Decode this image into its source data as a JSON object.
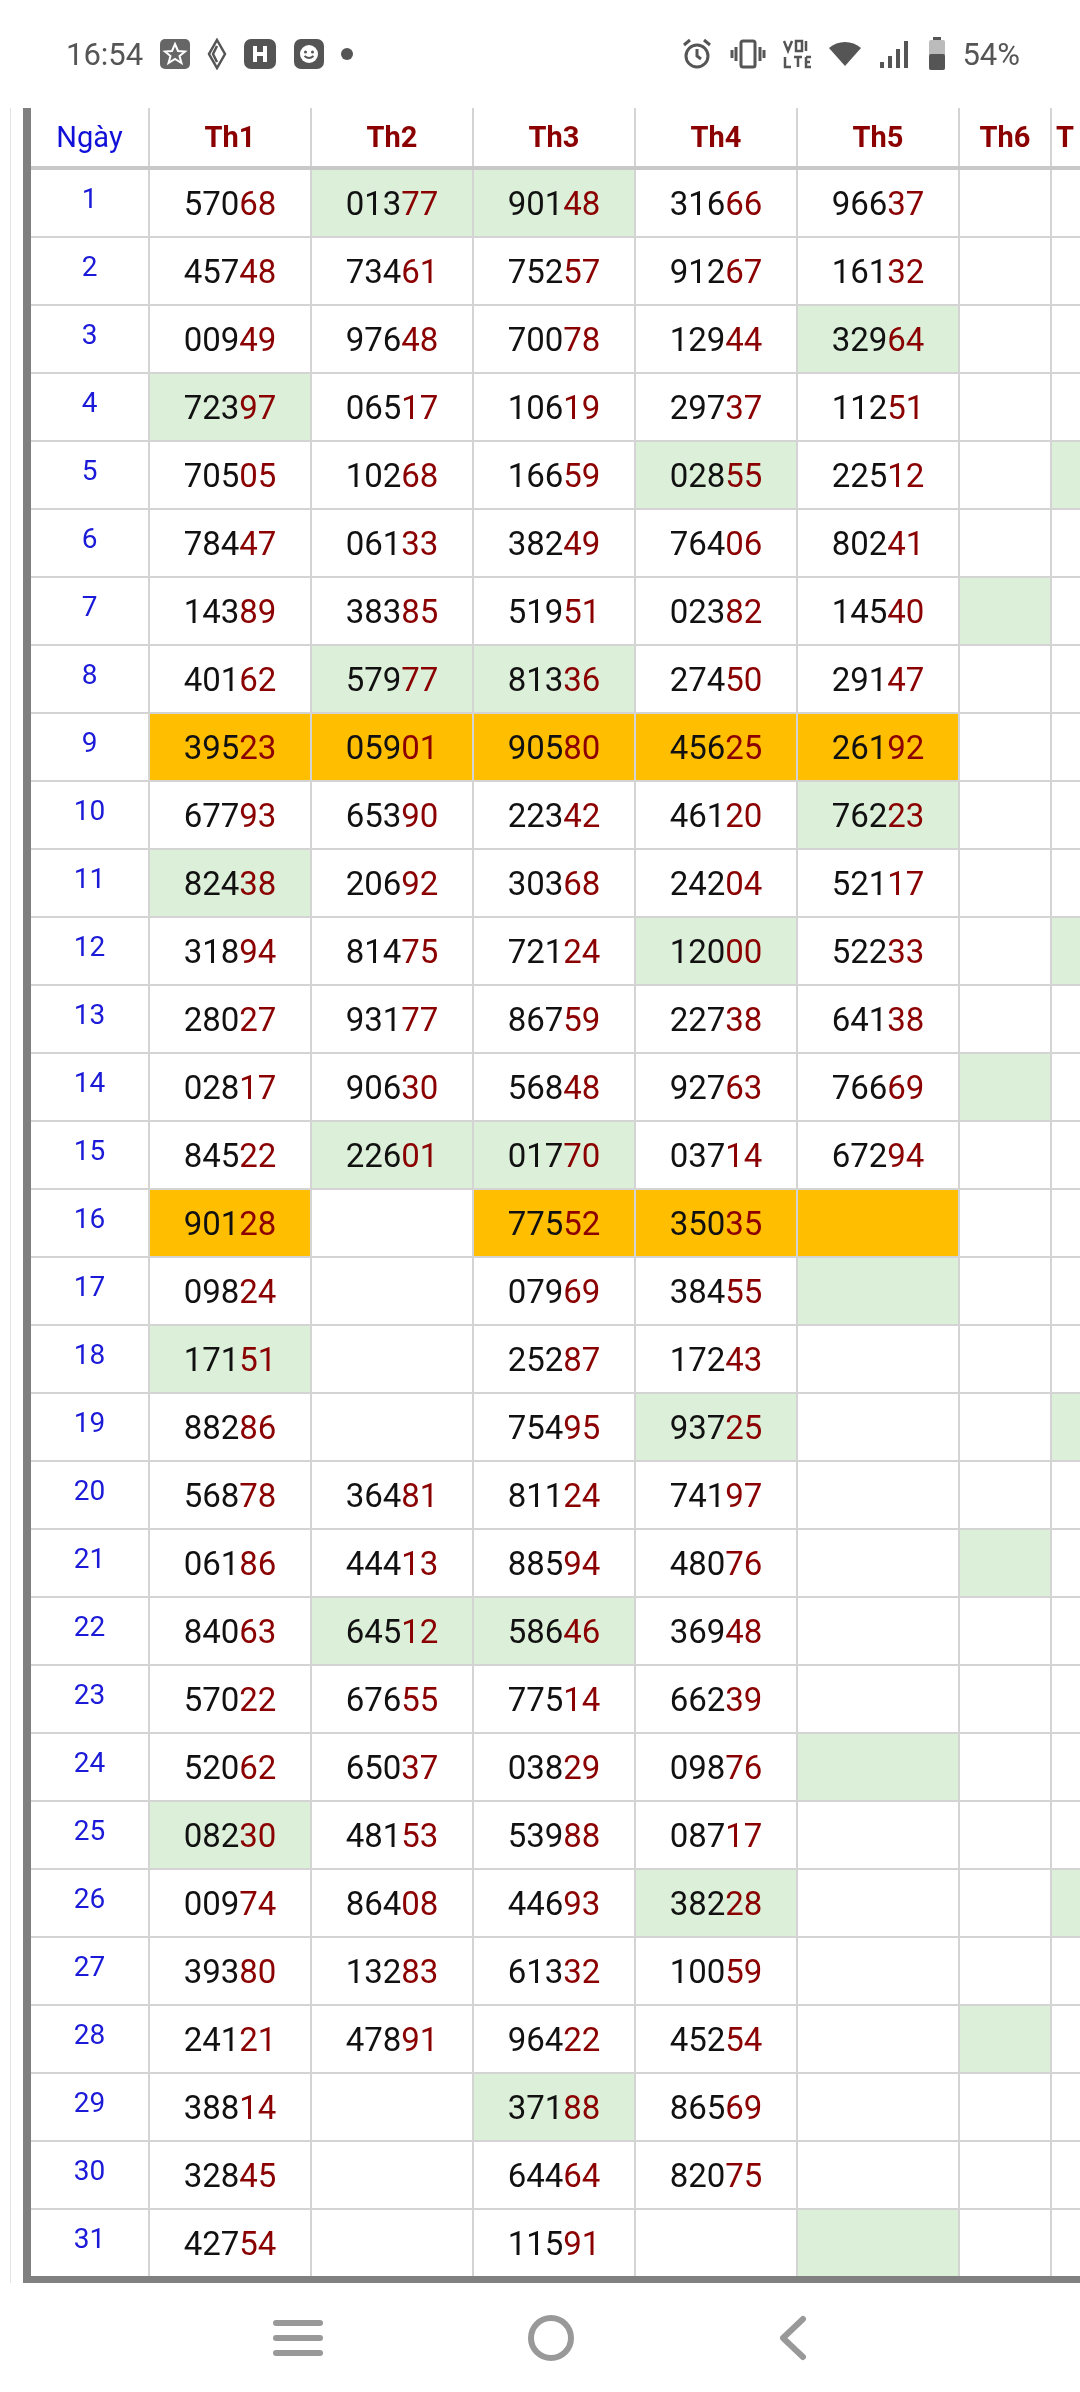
{
  "status_bar": {
    "time": "16:54",
    "battery": "54%"
  },
  "table": {
    "columns": [
      "Ngày",
      "Th1",
      "Th2",
      "Th3",
      "Th4",
      "Th5",
      "Th6",
      "T"
    ],
    "rows": [
      {
        "cells": [
          {
            "kind": "day",
            "value": "1"
          },
          {
            "kind": "number",
            "value": "57068"
          },
          {
            "kind": "number",
            "value": "01377",
            "color": "#dcefd9"
          },
          {
            "kind": "number",
            "value": "90148",
            "color": "#dcefd9"
          },
          {
            "kind": "number",
            "value": "31666"
          },
          {
            "kind": "number",
            "value": "96637"
          },
          {
            "kind": "number"
          },
          {
            "kind": "number"
          }
        ]
      },
      {
        "cells": [
          {
            "kind": "day",
            "value": "2"
          },
          {
            "kind": "number",
            "value": "45748"
          },
          {
            "kind": "number",
            "value": "73461"
          },
          {
            "kind": "number",
            "value": "75257"
          },
          {
            "kind": "number",
            "value": "91267"
          },
          {
            "kind": "number",
            "value": "16132"
          },
          {
            "kind": "number"
          },
          {
            "kind": "number"
          }
        ]
      },
      {
        "cells": [
          {
            "kind": "day",
            "value": "3"
          },
          {
            "kind": "number",
            "value": "00949"
          },
          {
            "kind": "number",
            "value": "97648"
          },
          {
            "kind": "number",
            "value": "70078"
          },
          {
            "kind": "number",
            "value": "12944"
          },
          {
            "kind": "number",
            "value": "32964",
            "color": "#dcefd9"
          },
          {
            "kind": "number"
          },
          {
            "kind": "number"
          }
        ]
      },
      {
        "cells": [
          {
            "kind": "day",
            "value": "4"
          },
          {
            "kind": "number",
            "value": "72397",
            "color": "#dcefd9"
          },
          {
            "kind": "number",
            "value": "06517"
          },
          {
            "kind": "number",
            "value": "10619"
          },
          {
            "kind": "number",
            "value": "29737"
          },
          {
            "kind": "number",
            "value": "11251"
          },
          {
            "kind": "number"
          },
          {
            "kind": "number"
          }
        ]
      },
      {
        "cells": [
          {
            "kind": "day",
            "value": "5"
          },
          {
            "kind": "number",
            "value": "70505"
          },
          {
            "kind": "number",
            "value": "10268"
          },
          {
            "kind": "number",
            "value": "16659"
          },
          {
            "kind": "number",
            "value": "02855",
            "color": "#dcefd9"
          },
          {
            "kind": "number",
            "value": "22512"
          },
          {
            "kind": "number"
          },
          {
            "kind": "number",
            "color": "#dcefd9"
          }
        ]
      },
      {
        "cells": [
          {
            "kind": "day",
            "value": "6"
          },
          {
            "kind": "number",
            "value": "78447"
          },
          {
            "kind": "number",
            "value": "06133"
          },
          {
            "kind": "number",
            "value": "38249"
          },
          {
            "kind": "number",
            "value": "76406"
          },
          {
            "kind": "number",
            "value": "80241"
          },
          {
            "kind": "number"
          },
          {
            "kind": "number"
          }
        ]
      },
      {
        "cells": [
          {
            "kind": "day",
            "value": "7"
          },
          {
            "kind": "number",
            "value": "14389"
          },
          {
            "kind": "number",
            "value": "38385"
          },
          {
            "kind": "number",
            "value": "51951"
          },
          {
            "kind": "number",
            "value": "02382"
          },
          {
            "kind": "number",
            "value": "14540"
          },
          {
            "kind": "number",
            "color": "#dcefd9"
          },
          {
            "kind": "number"
          }
        ]
      },
      {
        "cells": [
          {
            "kind": "day",
            "value": "8"
          },
          {
            "kind": "number",
            "value": "40162"
          },
          {
            "kind": "number",
            "value": "57977",
            "color": "#dcefd9"
          },
          {
            "kind": "number",
            "value": "81336",
            "color": "#dcefd9"
          },
          {
            "kind": "number",
            "value": "27450"
          },
          {
            "kind": "number",
            "value": "29147"
          },
          {
            "kind": "number"
          },
          {
            "kind": "number"
          }
        ]
      },
      {
        "cells": [
          {
            "kind": "day",
            "value": "9"
          },
          {
            "kind": "number",
            "value": "39523",
            "color": "#ffbf00"
          },
          {
            "kind": "number",
            "value": "05901",
            "color": "#ffbf00"
          },
          {
            "kind": "number",
            "value": "90580",
            "color": "#ffbf00"
          },
          {
            "kind": "number",
            "value": "45625",
            "color": "#ffbf00"
          },
          {
            "kind": "number",
            "value": "26192",
            "color": "#ffbf00"
          },
          {
            "kind": "number"
          },
          {
            "kind": "number"
          }
        ]
      },
      {
        "cells": [
          {
            "kind": "day",
            "value": "10"
          },
          {
            "kind": "number",
            "value": "67793"
          },
          {
            "kind": "number",
            "value": "65390"
          },
          {
            "kind": "number",
            "value": "22342"
          },
          {
            "kind": "number",
            "value": "46120"
          },
          {
            "kind": "number",
            "value": "76223",
            "color": "#dcefd9"
          },
          {
            "kind": "number"
          },
          {
            "kind": "number"
          }
        ]
      },
      {
        "cells": [
          {
            "kind": "day",
            "value": "11"
          },
          {
            "kind": "number",
            "value": "82438",
            "color": "#dcefd9"
          },
          {
            "kind": "number",
            "value": "20692"
          },
          {
            "kind": "number",
            "value": "30368"
          },
          {
            "kind": "number",
            "value": "24204"
          },
          {
            "kind": "number",
            "value": "52117"
          },
          {
            "kind": "number"
          },
          {
            "kind": "number"
          }
        ]
      },
      {
        "cells": [
          {
            "kind": "day",
            "value": "12"
          },
          {
            "kind": "number",
            "value": "31894"
          },
          {
            "kind": "number",
            "value": "81475"
          },
          {
            "kind": "number",
            "value": "72124"
          },
          {
            "kind": "number",
            "value": "12000",
            "color": "#dcefd9"
          },
          {
            "kind": "number",
            "value": "52233"
          },
          {
            "kind": "number"
          },
          {
            "kind": "number",
            "color": "#dcefd9"
          }
        ]
      },
      {
        "cells": [
          {
            "kind": "day",
            "value": "13"
          },
          {
            "kind": "number",
            "value": "28027"
          },
          {
            "kind": "number",
            "value": "93177"
          },
          {
            "kind": "number",
            "value": "86759"
          },
          {
            "kind": "number",
            "value": "22738"
          },
          {
            "kind": "number",
            "value": "64138"
          },
          {
            "kind": "number"
          },
          {
            "kind": "number"
          }
        ]
      },
      {
        "cells": [
          {
            "kind": "day",
            "value": "14"
          },
          {
            "kind": "number",
            "value": "02817"
          },
          {
            "kind": "number",
            "value": "90630"
          },
          {
            "kind": "number",
            "value": "56848"
          },
          {
            "kind": "number",
            "value": "92763"
          },
          {
            "kind": "number",
            "value": "76669"
          },
          {
            "kind": "number",
            "color": "#dcefd9"
          },
          {
            "kind": "number"
          }
        ]
      },
      {
        "cells": [
          {
            "kind": "day",
            "value": "15"
          },
          {
            "kind": "number",
            "value": "84522"
          },
          {
            "kind": "number",
            "value": "22601",
            "color": "#dcefd9"
          },
          {
            "kind": "number",
            "value": "01770",
            "color": "#dcefd9"
          },
          {
            "kind": "number",
            "value": "03714"
          },
          {
            "kind": "number",
            "value": "67294"
          },
          {
            "kind": "number"
          },
          {
            "kind": "number"
          }
        ]
      },
      {
        "cells": [
          {
            "kind": "day",
            "value": "16"
          },
          {
            "kind": "number",
            "value": "90128",
            "color": "#ffbf00"
          },
          {
            "kind": "number"
          },
          {
            "kind": "number",
            "value": "77552",
            "color": "#ffbf00"
          },
          {
            "kind": "number",
            "value": "35035",
            "color": "#ffbf00"
          },
          {
            "kind": "number",
            "color": "#ffbf00"
          },
          {
            "kind": "number"
          },
          {
            "kind": "number"
          }
        ]
      },
      {
        "cells": [
          {
            "kind": "day",
            "value": "17"
          },
          {
            "kind": "number",
            "value": "09824"
          },
          {
            "kind": "number"
          },
          {
            "kind": "number",
            "value": "07969"
          },
          {
            "kind": "number",
            "value": "38455"
          },
          {
            "kind": "number",
            "color": "#dcefd9"
          },
          {
            "kind": "number"
          },
          {
            "kind": "number"
          }
        ]
      },
      {
        "cells": [
          {
            "kind": "day",
            "value": "18"
          },
          {
            "kind": "number",
            "value": "17151",
            "color": "#dcefd9"
          },
          {
            "kind": "number"
          },
          {
            "kind": "number",
            "value": "25287"
          },
          {
            "kind": "number",
            "value": "17243"
          },
          {
            "kind": "number"
          },
          {
            "kind": "number"
          },
          {
            "kind": "number"
          }
        ]
      },
      {
        "cells": [
          {
            "kind": "day",
            "value": "19"
          },
          {
            "kind": "number",
            "value": "88286"
          },
          {
            "kind": "number"
          },
          {
            "kind": "number",
            "value": "75495"
          },
          {
            "kind": "number",
            "value": "93725",
            "color": "#dcefd9"
          },
          {
            "kind": "number"
          },
          {
            "kind": "number"
          },
          {
            "kind": "number",
            "color": "#dcefd9"
          }
        ]
      },
      {
        "cells": [
          {
            "kind": "day",
            "value": "20"
          },
          {
            "kind": "number",
            "value": "56878"
          },
          {
            "kind": "number",
            "value": "36481"
          },
          {
            "kind": "number",
            "value": "81124"
          },
          {
            "kind": "number",
            "value": "74197"
          },
          {
            "kind": "number"
          },
          {
            "kind": "number"
          },
          {
            "kind": "number"
          }
        ]
      },
      {
        "cells": [
          {
            "kind": "day",
            "value": "21"
          },
          {
            "kind": "number",
            "value": "06186"
          },
          {
            "kind": "number",
            "value": "44413"
          },
          {
            "kind": "number",
            "value": "88594"
          },
          {
            "kind": "number",
            "value": "48076"
          },
          {
            "kind": "number"
          },
          {
            "kind": "number",
            "color": "#dcefd9"
          },
          {
            "kind": "number"
          }
        ]
      },
      {
        "cells": [
          {
            "kind": "day",
            "value": "22"
          },
          {
            "kind": "number",
            "value": "84063"
          },
          {
            "kind": "number",
            "value": "64512",
            "color": "#dcefd9"
          },
          {
            "kind": "number",
            "value": "58646",
            "color": "#dcefd9"
          },
          {
            "kind": "number",
            "value": "36948"
          },
          {
            "kind": "number"
          },
          {
            "kind": "number"
          },
          {
            "kind": "number"
          }
        ]
      },
      {
        "cells": [
          {
            "kind": "day",
            "value": "23"
          },
          {
            "kind": "number",
            "value": "57022"
          },
          {
            "kind": "number",
            "value": "67655"
          },
          {
            "kind": "number",
            "value": "77514"
          },
          {
            "kind": "number",
            "value": "66239"
          },
          {
            "kind": "number"
          },
          {
            "kind": "number"
          },
          {
            "kind": "number"
          }
        ]
      },
      {
        "cells": [
          {
            "kind": "day",
            "value": "24"
          },
          {
            "kind": "number",
            "value": "52062"
          },
          {
            "kind": "number",
            "value": "65037"
          },
          {
            "kind": "number",
            "value": "03829"
          },
          {
            "kind": "number",
            "value": "09876"
          },
          {
            "kind": "number",
            "color": "#dcefd9"
          },
          {
            "kind": "number"
          },
          {
            "kind": "number"
          }
        ]
      },
      {
        "cells": [
          {
            "kind": "day",
            "value": "25"
          },
          {
            "kind": "number",
            "value": "08230",
            "color": "#dcefd9"
          },
          {
            "kind": "number",
            "value": "48153"
          },
          {
            "kind": "number",
            "value": "53988"
          },
          {
            "kind": "number",
            "value": "08717"
          },
          {
            "kind": "number"
          },
          {
            "kind": "number"
          },
          {
            "kind": "number"
          }
        ]
      },
      {
        "cells": [
          {
            "kind": "day",
            "value": "26"
          },
          {
            "kind": "number",
            "value": "00974"
          },
          {
            "kind": "number",
            "value": "86408"
          },
          {
            "kind": "number",
            "value": "44693"
          },
          {
            "kind": "number",
            "value": "38228",
            "color": "#dcefd9"
          },
          {
            "kind": "number"
          },
          {
            "kind": "number"
          },
          {
            "kind": "number",
            "color": "#dcefd9"
          }
        ]
      },
      {
        "cells": [
          {
            "kind": "day",
            "value": "27"
          },
          {
            "kind": "number",
            "value": "39380"
          },
          {
            "kind": "number",
            "value": "13283"
          },
          {
            "kind": "number",
            "value": "61332"
          },
          {
            "kind": "number",
            "value": "10059"
          },
          {
            "kind": "number"
          },
          {
            "kind": "number"
          },
          {
            "kind": "number"
          }
        ]
      },
      {
        "cells": [
          {
            "kind": "day",
            "value": "28"
          },
          {
            "kind": "number",
            "value": "24121"
          },
          {
            "kind": "number",
            "value": "47891"
          },
          {
            "kind": "number",
            "value": "96422"
          },
          {
            "kind": "number",
            "value": "45254"
          },
          {
            "kind": "number"
          },
          {
            "kind": "number",
            "color": "#dcefd9"
          },
          {
            "kind": "number"
          }
        ]
      },
      {
        "cells": [
          {
            "kind": "day",
            "value": "29"
          },
          {
            "kind": "number",
            "value": "38814"
          },
          {
            "kind": "number"
          },
          {
            "kind": "number",
            "value": "37188",
            "color": "#dcefd9"
          },
          {
            "kind": "number",
            "value": "86569"
          },
          {
            "kind": "number"
          },
          {
            "kind": "number"
          },
          {
            "kind": "number"
          }
        ]
      },
      {
        "cells": [
          {
            "kind": "day",
            "value": "30"
          },
          {
            "kind": "number",
            "value": "32845"
          },
          {
            "kind": "number"
          },
          {
            "kind": "number",
            "value": "64464"
          },
          {
            "kind": "number",
            "value": "82075"
          },
          {
            "kind": "number"
          },
          {
            "kind": "number"
          },
          {
            "kind": "number"
          }
        ]
      },
      {
        "cells": [
          {
            "kind": "day",
            "value": "31"
          },
          {
            "kind": "number",
            "value": "42754"
          },
          {
            "kind": "number"
          },
          {
            "kind": "number",
            "value": "11591"
          },
          {
            "kind": "number"
          },
          {
            "kind": "number",
            "color": "#dcefd9"
          },
          {
            "kind": "number"
          },
          {
            "kind": "number"
          }
        ]
      }
    ]
  }
}
